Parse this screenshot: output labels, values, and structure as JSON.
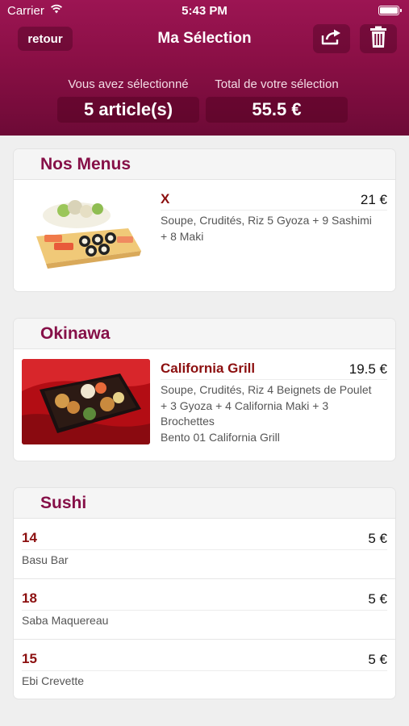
{
  "status_bar": {
    "carrier": "Carrier",
    "time": "5:43 PM"
  },
  "nav": {
    "back_label": "retour",
    "title": "Ma Sélection",
    "share_icon": "share-icon",
    "trash_icon": "trash-icon"
  },
  "summary": {
    "selected_label": "Vous avez sélectionné",
    "selected_value": "5 article(s)",
    "total_label": "Total de votre sélection",
    "total_value": "55.5 €"
  },
  "colors": {
    "brand": "#8a0f45",
    "section_title": "#861048",
    "item_name": "#8c0f0f"
  },
  "sections": [
    {
      "title": "Nos Menus",
      "items": [
        {
          "name": "X",
          "price": "21 €",
          "desc": [
            "Soupe, Crudités, Riz 5 Gyoza + 9 Sashimi",
            "+ 8 Maki"
          ]
        }
      ]
    },
    {
      "title": "Okinawa",
      "items": [
        {
          "name": "California Grill",
          "price": "19.5 €",
          "desc": [
            "Soupe, Crudités, Riz 4 Beignets de Poulet",
            "+ 3 Gyoza + 4 California Maki + 3",
            "Brochettes",
            "Bento 01 California Grill"
          ]
        }
      ]
    },
    {
      "title": "Sushi",
      "items": [
        {
          "name": "14",
          "price": "5 €",
          "desc": "Basu Bar"
        },
        {
          "name": "18",
          "price": "5 €",
          "desc": "Saba Maquereau"
        },
        {
          "name": "15",
          "price": "5 €",
          "desc": "Ebi Crevette"
        }
      ]
    }
  ]
}
